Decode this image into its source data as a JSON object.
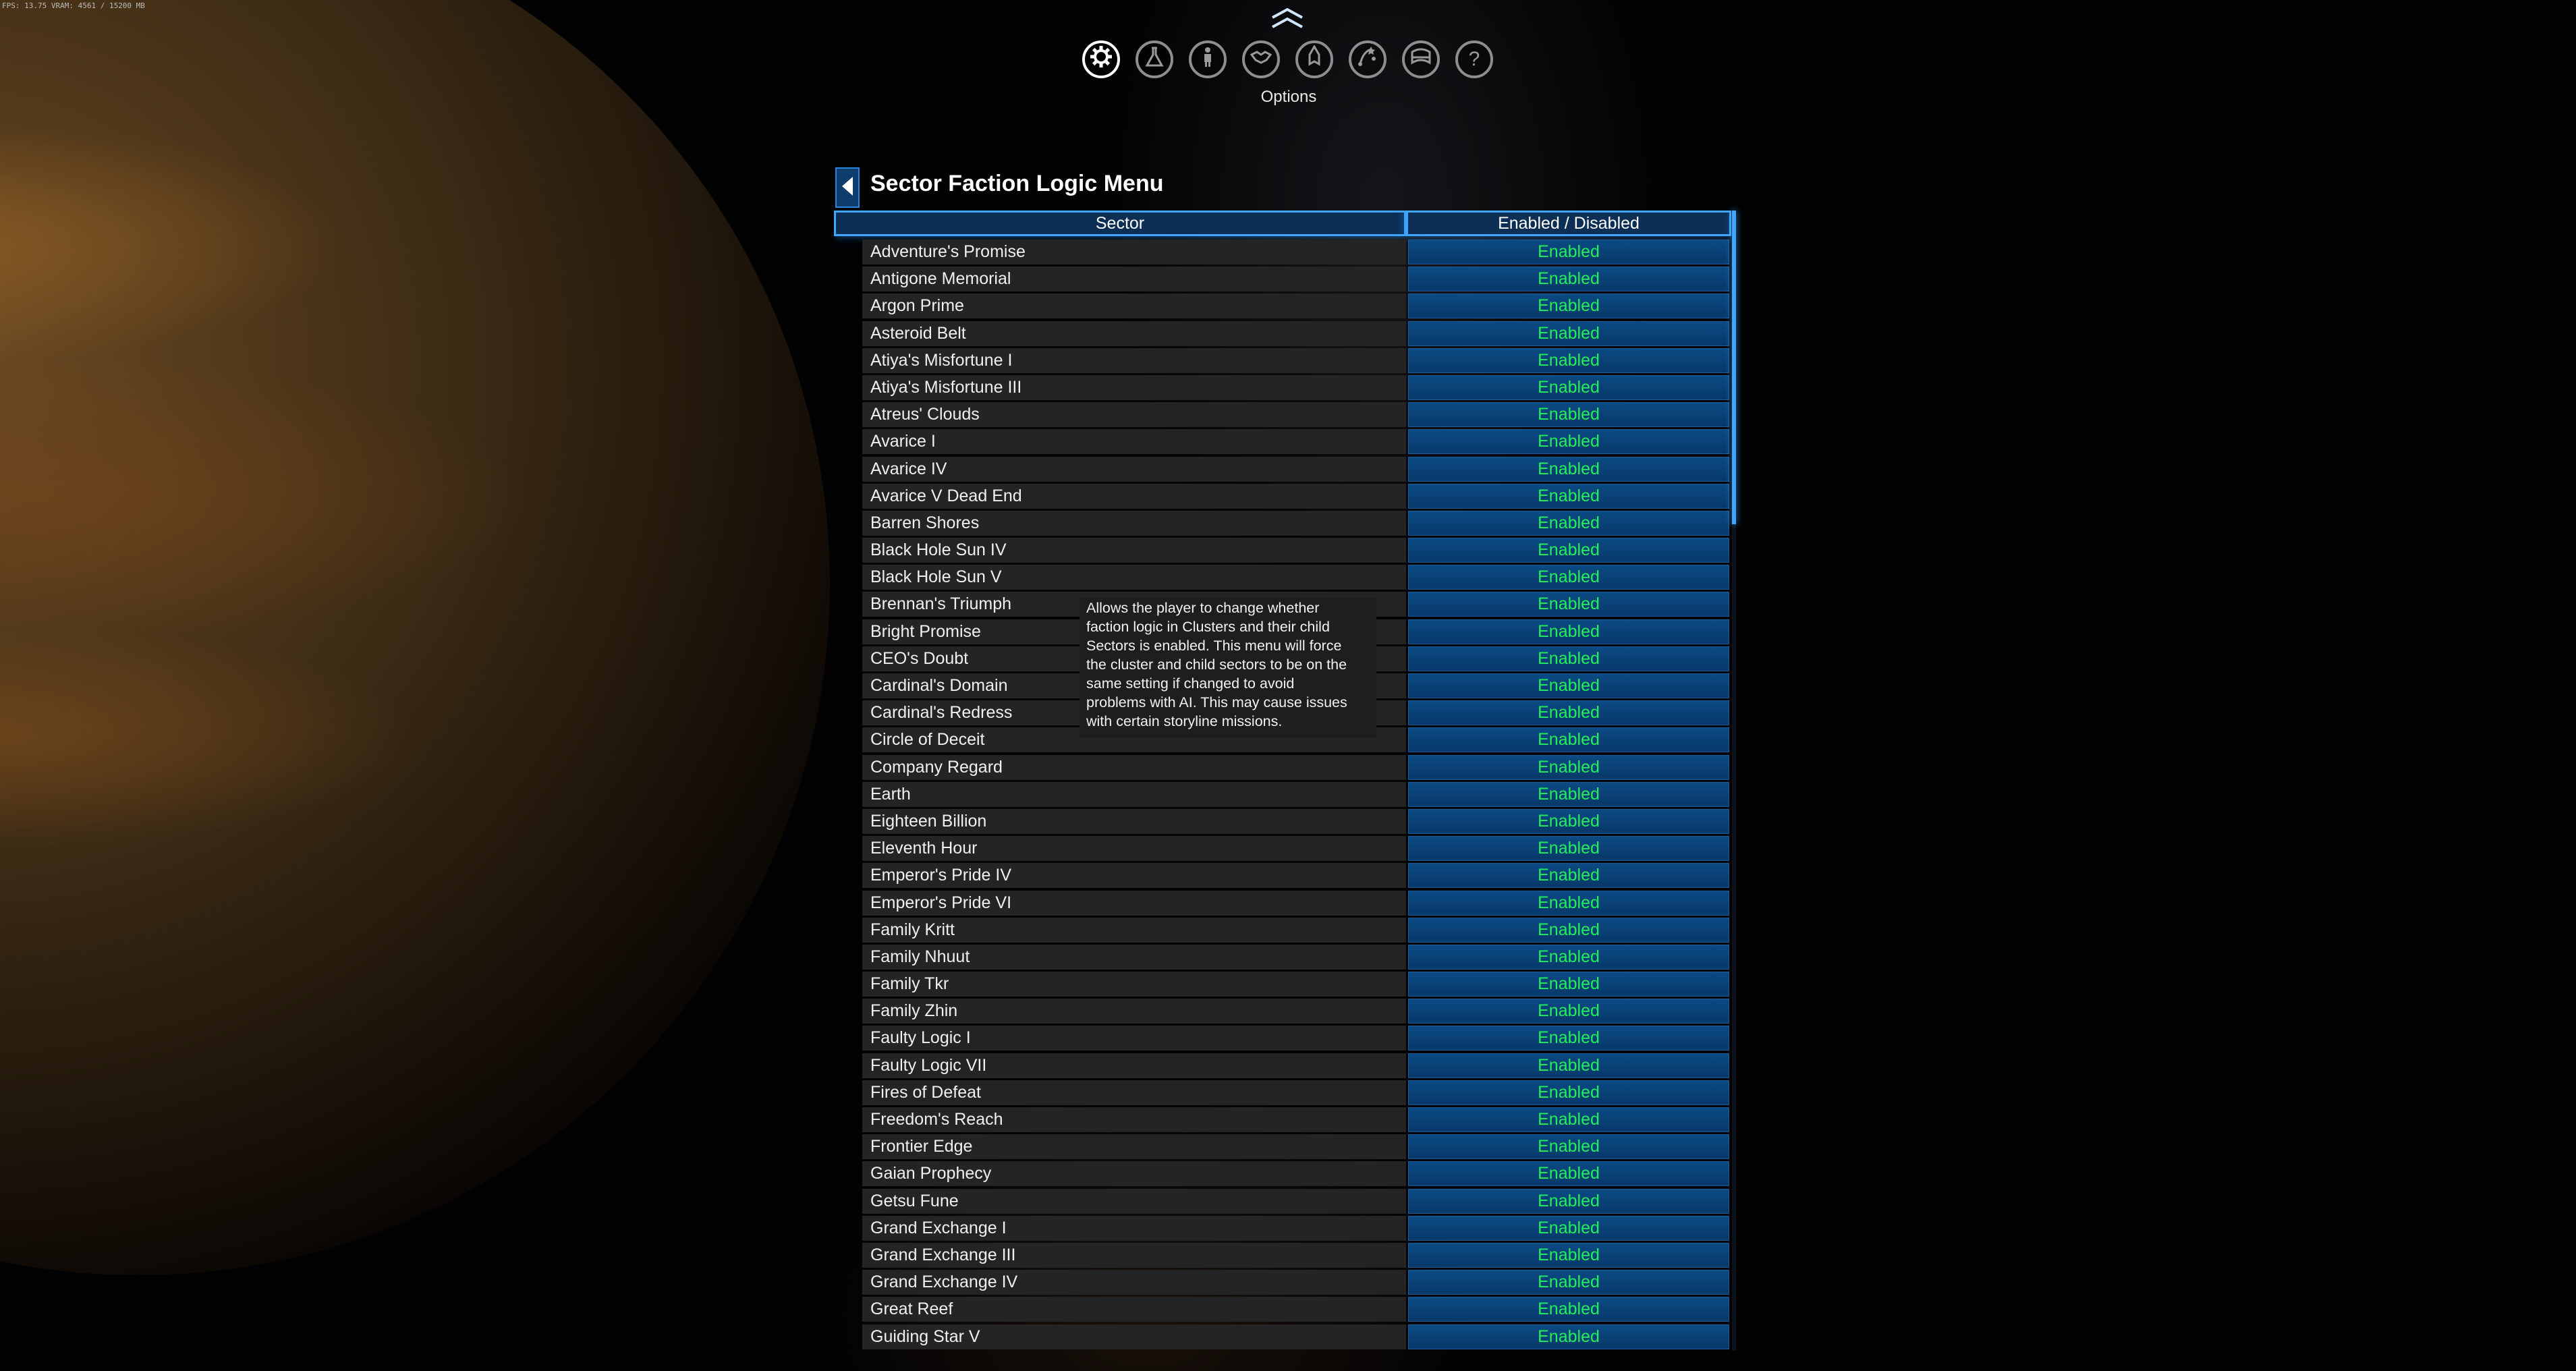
{
  "debug": {
    "fps_text": "FPS: 13.75 VRAM: 4561 / 15200 MB"
  },
  "nav": {
    "icons": [
      "gear-icon",
      "flask-icon",
      "person-icon",
      "handshake-icon",
      "ship-icon",
      "star-map-icon",
      "encyclopedia-icon",
      "help-icon"
    ],
    "active_label": "Options",
    "help_glyph": "?"
  },
  "panel": {
    "title": "Sector Faction Logic Menu",
    "columns": {
      "sector": "Sector",
      "enabled": "Enabled / Disabled"
    },
    "rows": [
      {
        "sector": "Adventure's Promise",
        "status": "Enabled"
      },
      {
        "sector": "Antigone Memorial",
        "status": "Enabled"
      },
      {
        "sector": "Argon Prime",
        "status": "Enabled"
      },
      {
        "sector": "Asteroid Belt",
        "status": "Enabled"
      },
      {
        "sector": "Atiya's Misfortune I",
        "status": "Enabled"
      },
      {
        "sector": "Atiya's Misfortune III",
        "status": "Enabled"
      },
      {
        "sector": "Atreus' Clouds",
        "status": "Enabled"
      },
      {
        "sector": "Avarice I",
        "status": "Enabled"
      },
      {
        "sector": "Avarice IV",
        "status": "Enabled"
      },
      {
        "sector": "Avarice V Dead End",
        "status": "Enabled"
      },
      {
        "sector": "Barren Shores",
        "status": "Enabled"
      },
      {
        "sector": "Black Hole Sun IV",
        "status": "Enabled"
      },
      {
        "sector": "Black Hole Sun V",
        "status": "Enabled"
      },
      {
        "sector": "Brennan's Triumph",
        "status": "Enabled"
      },
      {
        "sector": "Bright Promise",
        "status": "Enabled"
      },
      {
        "sector": "CEO's Doubt",
        "status": "Enabled"
      },
      {
        "sector": "Cardinal's Domain",
        "status": "Enabled"
      },
      {
        "sector": "Cardinal's Redress",
        "status": "Enabled"
      },
      {
        "sector": "Circle of Deceit",
        "status": "Enabled"
      },
      {
        "sector": "Company Regard",
        "status": "Enabled"
      },
      {
        "sector": "Earth",
        "status": "Enabled"
      },
      {
        "sector": "Eighteen Billion",
        "status": "Enabled"
      },
      {
        "sector": "Eleventh Hour",
        "status": "Enabled"
      },
      {
        "sector": "Emperor's Pride IV",
        "status": "Enabled"
      },
      {
        "sector": "Emperor's Pride VI",
        "status": "Enabled"
      },
      {
        "sector": "Family Kritt",
        "status": "Enabled"
      },
      {
        "sector": "Family Nhuut",
        "status": "Enabled"
      },
      {
        "sector": "Family Tkr",
        "status": "Enabled"
      },
      {
        "sector": "Family Zhin",
        "status": "Enabled"
      },
      {
        "sector": "Faulty Logic I",
        "status": "Enabled"
      },
      {
        "sector": "Faulty Logic VII",
        "status": "Enabled"
      },
      {
        "sector": "Fires of Defeat",
        "status": "Enabled"
      },
      {
        "sector": "Freedom's Reach",
        "status": "Enabled"
      },
      {
        "sector": "Frontier Edge",
        "status": "Enabled"
      },
      {
        "sector": "Gaian Prophecy",
        "status": "Enabled"
      },
      {
        "sector": "Getsu Fune",
        "status": "Enabled"
      },
      {
        "sector": "Grand Exchange I",
        "status": "Enabled"
      },
      {
        "sector": "Grand Exchange III",
        "status": "Enabled"
      },
      {
        "sector": "Grand Exchange IV",
        "status": "Enabled"
      },
      {
        "sector": "Great Reef",
        "status": "Enabled"
      },
      {
        "sector": "Guiding Star V",
        "status": "Enabled"
      }
    ]
  },
  "tooltip": {
    "lines": [
      "Allows the player to change whether",
      "faction logic in Clusters and their child",
      "Sectors is enabled. This menu will force",
      "the cluster and child sectors to be on the",
      "same setting if changed to avoid",
      "problems with AI. This may cause issues",
      "with certain storyline missions."
    ]
  },
  "colors": {
    "accent": "#3ea6ff",
    "enabled_text": "#22f05a",
    "enabled_cell": "#0b4a83",
    "row_bg": "#242424"
  }
}
